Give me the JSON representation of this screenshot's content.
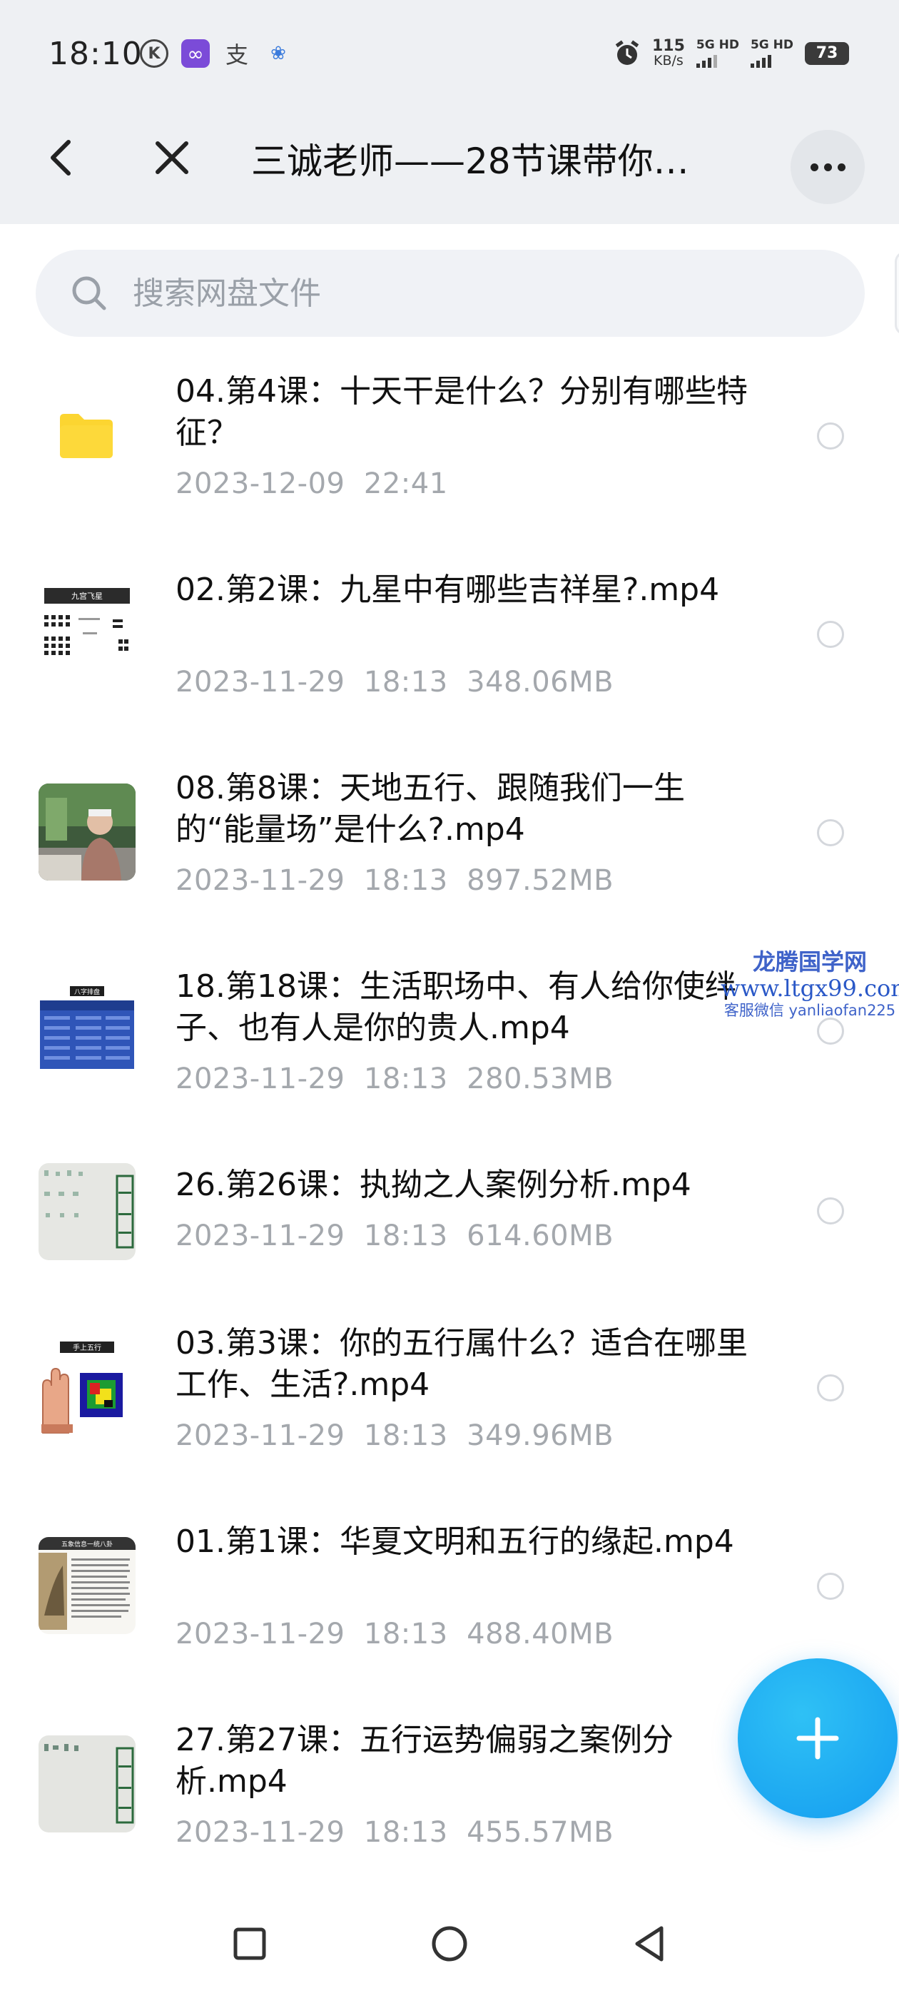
{
  "status_bar": {
    "time": "18:10",
    "app_icons": [
      "k-icon",
      "infinity-app-icon",
      "alipay-icon",
      "location-pin-icon"
    ],
    "speed_value": "115",
    "speed_unit": "KB/s",
    "network_1": "5G HD",
    "network_2": "5G HD",
    "battery": "73"
  },
  "header": {
    "title": "三诚老师——28节课带你…"
  },
  "search": {
    "placeholder": "搜索网盘文件"
  },
  "files": [
    {
      "name": "04.第4课：十天干是什么？分别有哪些特征？",
      "date": "2023-12-09",
      "time": "22:41",
      "size": "",
      "kind": "folder"
    },
    {
      "name": "02.第2课：九星中有哪些吉祥星?.mp4",
      "date": "2023-11-29",
      "time": "18:13",
      "size": "348.06MB",
      "kind": "video"
    },
    {
      "name": "08.第8课：天地五行、跟随我们一生的“能量场”是什么?.mp4",
      "date": "2023-11-29",
      "time": "18:13",
      "size": "897.52MB",
      "kind": "video"
    },
    {
      "name": "18.第18课：生活职场中、有人给你使绊子、也有人是你的贵人.mp4",
      "date": "2023-11-29",
      "time": "18:13",
      "size": "280.53MB",
      "kind": "video"
    },
    {
      "name": "26.第26课：执拗之人案例分析.mp4",
      "date": "2023-11-29",
      "time": "18:13",
      "size": "614.60MB",
      "kind": "video"
    },
    {
      "name": "03.第3课：你的五行属什么？适合在哪里工作、生活?.mp4",
      "date": "2023-11-29",
      "time": "18:13",
      "size": "349.96MB",
      "kind": "video"
    },
    {
      "name": "01.第1课：华夏文明和五行的缘起.mp4",
      "date": "2023-11-29",
      "time": "18:13",
      "size": "488.40MB",
      "kind": "video"
    },
    {
      "name": "27.第27课：五行运势偏弱之案例分析.mp4",
      "date": "2023-11-29",
      "time": "18:13",
      "size": "455.57MB",
      "kind": "video"
    }
  ],
  "thumb_text": {
    "t1": "九宫飞星",
    "t4": "八字排盘",
    "t6": "手上五行",
    "t7": "五象信息一统八卦"
  },
  "watermark": {
    "line1": "龙腾国学网",
    "line2": "www.ltgx99.com",
    "line3": "客服微信 yanliaofan225"
  },
  "colors": {
    "accent": "#1aa6f2",
    "folder": "#fcd531",
    "header_bg": "#eef0f3",
    "meta_text": "#a4a8ad"
  }
}
